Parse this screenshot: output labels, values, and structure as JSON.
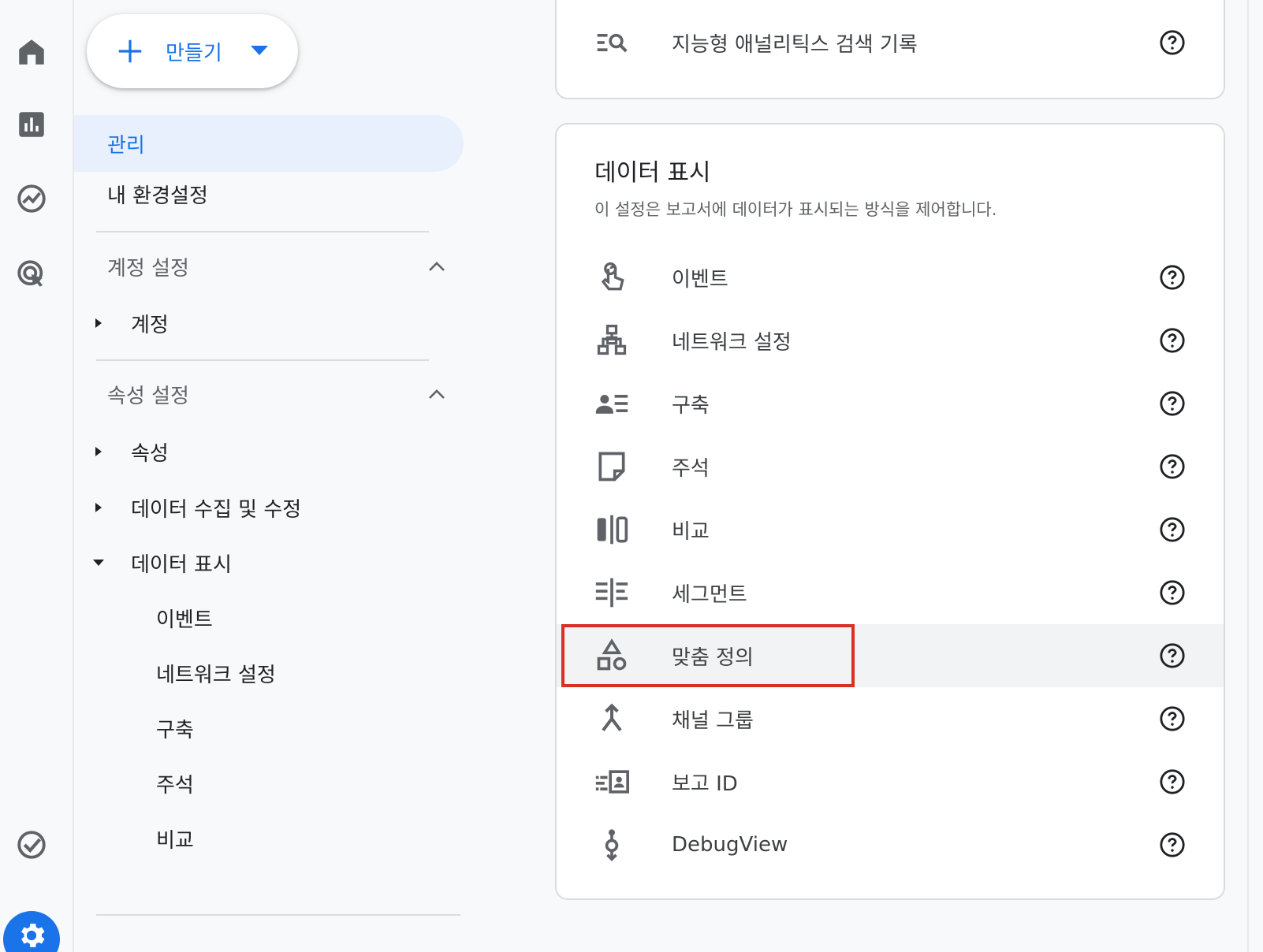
{
  "rail": {
    "icons": [
      "home-icon",
      "reports-icon",
      "explore-icon",
      "advertising-icon",
      "configure-icon",
      "admin-gear-icon"
    ]
  },
  "sidebar": {
    "create_label": "만들기",
    "admin_label": "관리",
    "prefs_label": "내 환경설정",
    "account_section": "계정 설정",
    "account_item": "계정",
    "property_section": "속성 설정",
    "property_item": "속성",
    "data_collection_item": "데이터 수집 및 수정",
    "data_display_item": "데이터 표시",
    "sub_items": [
      "이벤트",
      "네트워크 설정",
      "구축",
      "주석",
      "비교"
    ]
  },
  "top_card": {
    "row_label": "지능형 애널리틱스 검색 기록"
  },
  "display_card": {
    "title": "데이터 표시",
    "description": "이 설정은 보고서에 데이터가 표시되는 방식을 제어합니다.",
    "rows": [
      {
        "label": "이벤트",
        "icon": "touch-icon"
      },
      {
        "label": "네트워크 설정",
        "icon": "network-icon"
      },
      {
        "label": "구축",
        "icon": "audience-icon"
      },
      {
        "label": "주석",
        "icon": "note-icon"
      },
      {
        "label": "비교",
        "icon": "compare-icon"
      },
      {
        "label": "세그먼트",
        "icon": "segment-icon"
      },
      {
        "label": "맞춤 정의",
        "icon": "shapes-icon",
        "highlighted": true
      },
      {
        "label": "채널 그룹",
        "icon": "merge-icon"
      },
      {
        "label": "보고 ID",
        "icon": "reporting-id-icon"
      },
      {
        "label": "DebugView",
        "icon": "debug-icon"
      }
    ]
  },
  "colors": {
    "accent": "#1a73e8",
    "highlight_border": "#d93025",
    "active_nav_bg": "#e8f0fe"
  }
}
